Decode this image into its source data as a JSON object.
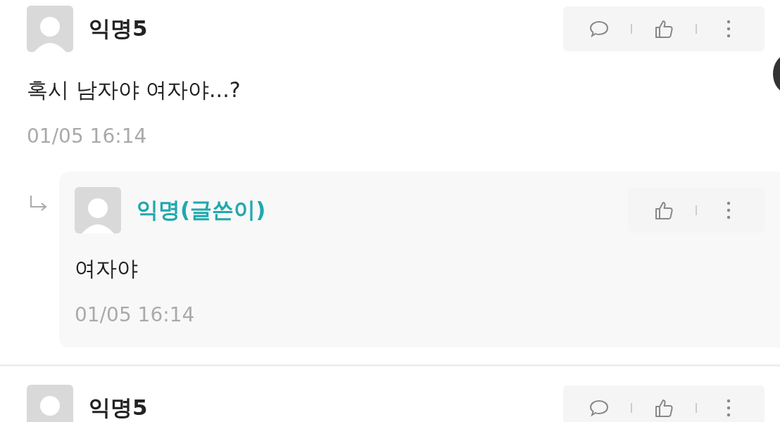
{
  "comments": [
    {
      "author": "익명5",
      "is_writer": false,
      "text": "혹시 남자야 여자야...?",
      "time": "01/05 16:14",
      "actions": [
        {
          "kind": "reply"
        },
        {
          "kind": "like"
        },
        {
          "kind": "more"
        }
      ],
      "replies": [
        {
          "author": "익명(글쓴이)",
          "is_writer": true,
          "text": "여자야",
          "time": "01/05 16:14",
          "actions": [
            {
              "kind": "like"
            },
            {
              "kind": "more"
            }
          ]
        }
      ]
    },
    {
      "author": "익명5",
      "is_writer": false,
      "actions": [
        {
          "kind": "reply"
        },
        {
          "kind": "like"
        },
        {
          "kind": "more"
        }
      ]
    }
  ]
}
